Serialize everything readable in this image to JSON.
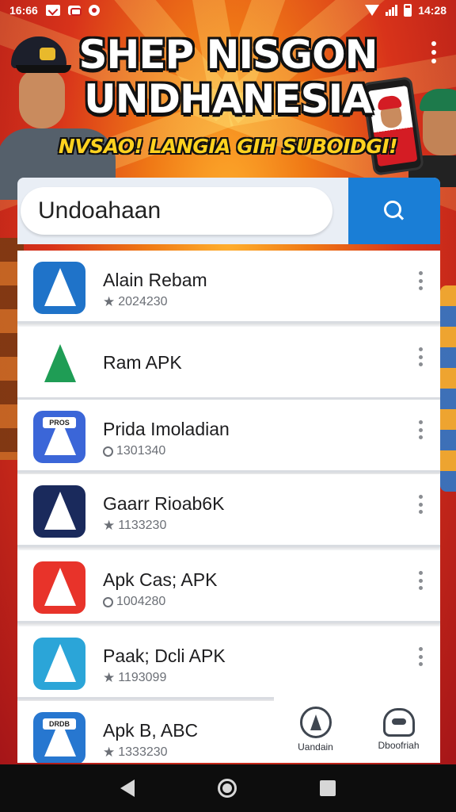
{
  "status_bar": {
    "time_left": "16:66",
    "time_right": "14:28"
  },
  "header": {
    "title_line1": "SHEP NISGON",
    "title_line2": "UNDHANESIA",
    "subtitle": "NVSAO! LANGIA GIH SUBOIDGI!"
  },
  "search": {
    "value": "Undoahaan",
    "placeholder": ""
  },
  "apps": [
    {
      "name": "Alain Rebam",
      "meta": "2024230",
      "meta_icon": "star-icon",
      "icon_bg": "#1f73c9",
      "icon_tag": ""
    },
    {
      "name": "Ram APK",
      "meta": "",
      "meta_icon": "",
      "icon_bg": "#ffffff",
      "icon_tag": ""
    },
    {
      "name": "Prida Imoladian",
      "meta": "1301340",
      "meta_icon": "ring-icon",
      "icon_bg": "#3b66d8",
      "icon_tag": "PROS"
    },
    {
      "name": "Gaarr Rioab6K",
      "meta": "1133230",
      "meta_icon": "star-icon",
      "icon_bg": "#1a2a5c",
      "icon_tag": ""
    },
    {
      "name": "Apk Cas; APK",
      "meta": "1004280",
      "meta_icon": "ring-icon",
      "icon_bg": "#e8332a",
      "icon_tag": ""
    },
    {
      "name": "Paak; Dcli APK",
      "meta": "1193099",
      "meta_icon": "star-icon",
      "icon_bg": "#2ba5d8",
      "icon_tag": ""
    },
    {
      "name": "Apk B, ABC",
      "meta": "1333230",
      "meta_icon": "star-icon",
      "icon_bg": "#2777d0",
      "icon_tag": "DRDB"
    }
  ],
  "bottom_actions": [
    {
      "label": "Uandain",
      "icon": "compass-icon"
    },
    {
      "label": "Dboofriah",
      "icon": "rocket-icon"
    }
  ],
  "colors": {
    "accent": "#1a7ed6",
    "poster_red": "#c81e1e",
    "poster_orange": "#f07a16",
    "title_yellow": "#ffd21f"
  }
}
